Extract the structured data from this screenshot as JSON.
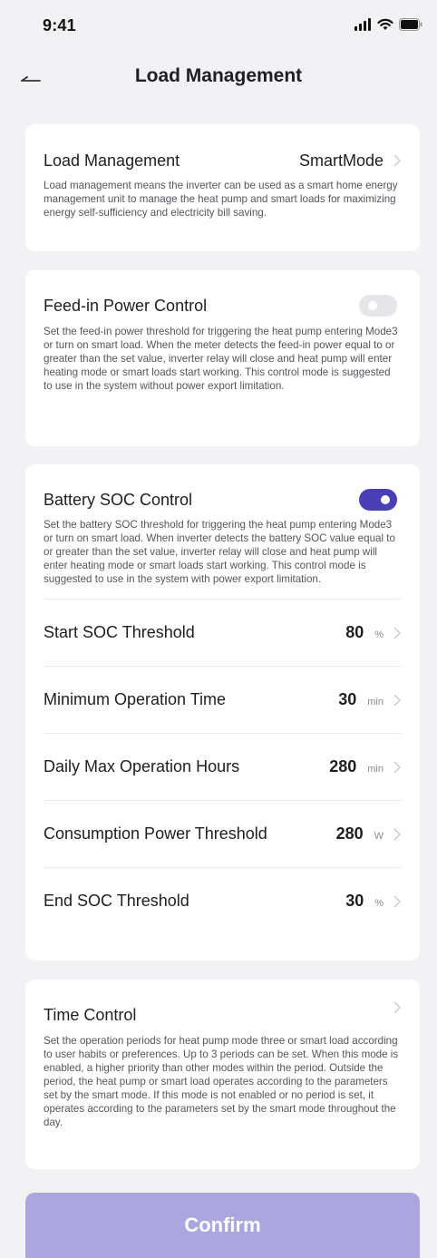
{
  "status_bar": {
    "time": "9:41"
  },
  "nav": {
    "title": "Load Management"
  },
  "load_management": {
    "title": "Load Management",
    "value": "SmartMode",
    "description": "Load management means the inverter can be used as a smart home energy management unit to manage the heat pump and smart loads for maximizing energy self-sufficiency and electricity bill saving."
  },
  "feed_in": {
    "title": "Feed-in Power Control",
    "enabled": false,
    "description": "Set the feed-in power threshold for triggering the heat pump entering Mode3 or turn on smart load. When the meter detects the feed-in power equal to or greater than the set value, inverter relay will close and heat pump will enter heating mode or smart loads start working. This control mode is suggested to use in the system without power export limitation."
  },
  "battery_soc": {
    "title": "Battery SOC Control",
    "enabled": true,
    "description": "Set the battery SOC threshold for triggering the heat pump entering Mode3 or turn on smart load. When inverter detects the battery SOC value equal to or greater than the set value, inverter relay will close and heat pump will enter heating mode or smart loads start working. This control mode is suggested to use in the system with power export limitation.",
    "rows": [
      {
        "label": "Start SOC Threshold",
        "value": "80",
        "unit": "%"
      },
      {
        "label": "Minimum Operation Time",
        "value": "30",
        "unit": "min"
      },
      {
        "label": "Daily Max Operation Hours",
        "value": "280",
        "unit": "min"
      },
      {
        "label": "Consumption Power Threshold",
        "value": "280",
        "unit": "W"
      },
      {
        "label": "End SOC Threshold",
        "value": "30",
        "unit": "%"
      }
    ]
  },
  "time_control": {
    "title": "Time Control",
    "description": "Set the operation periods for heat pump mode three or smart load according to user habits or preferences. Up to 3 periods can be set. When this mode is enabled, a higher priority than other modes within the period. Outside the period, the heat pump or smart load operates according to the parameters set by the smart mode. If this mode is not enabled or no period is set, it operates according to the parameters set by the smart mode throughout the day."
  },
  "confirm": {
    "label": "Confirm"
  },
  "colors": {
    "accent": "#4b3fb7",
    "confirm_bg": "#aba6dd",
    "background": "#f2f2f4",
    "toggle_off": "#e6e6ea"
  },
  "icons": [
    "back-arrow-icon",
    "chevron-right-icon",
    "signal-icon",
    "wifi-icon",
    "battery-icon"
  ]
}
